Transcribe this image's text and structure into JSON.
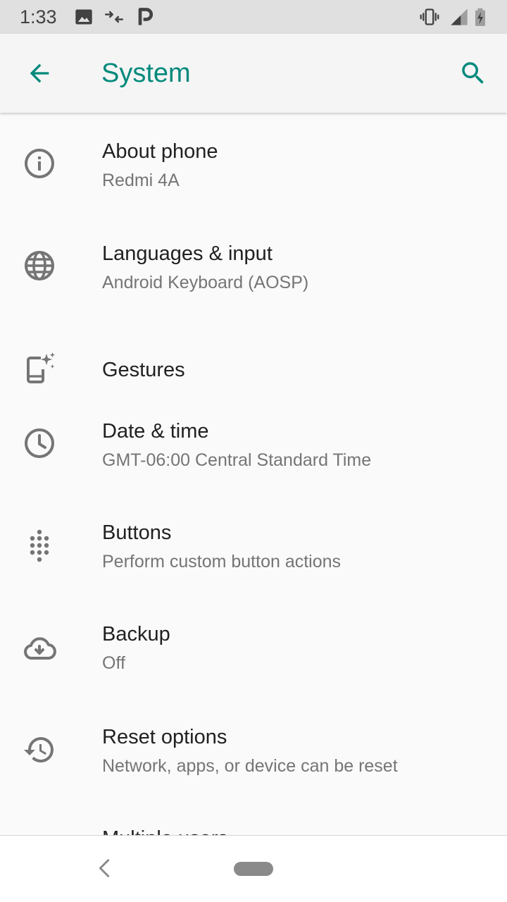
{
  "status_bar": {
    "time": "1:33",
    "icons": [
      "image-icon",
      "data-transfer-icon",
      "p-app-icon",
      "vibrate-icon",
      "signal-icon",
      "battery-charging-icon"
    ]
  },
  "app_bar": {
    "title": "System",
    "back_icon": "arrow-back-icon",
    "search_icon": "search-icon"
  },
  "items": [
    {
      "icon": "info-icon",
      "title": "About phone",
      "summary": "Redmi 4A"
    },
    {
      "icon": "globe-icon",
      "title": "Languages & input",
      "summary": "Android Keyboard (AOSP)"
    },
    {
      "icon": "gestures-icon",
      "title": "Gestures",
      "summary": ""
    },
    {
      "icon": "clock-icon",
      "title": "Date & time",
      "summary": "GMT-06:00 Central Standard Time"
    },
    {
      "icon": "dots-grid-icon",
      "title": "Buttons",
      "summary": "Perform custom button actions"
    },
    {
      "icon": "cloud-upload-icon",
      "title": "Backup",
      "summary": "Off"
    },
    {
      "icon": "history-icon",
      "title": "Reset options",
      "summary": "Network, apps, or device can be reset"
    },
    {
      "icon": "",
      "title": "Multiple users",
      "summary": ""
    }
  ],
  "colors": {
    "accent": "#00897b",
    "status_bar_bg": "#e0e0e0",
    "app_bar_bg": "#f5f5f5",
    "background": "#fafafa",
    "icon_gray": "#757575",
    "title_text": "#212121",
    "summary_text": "#757575"
  }
}
